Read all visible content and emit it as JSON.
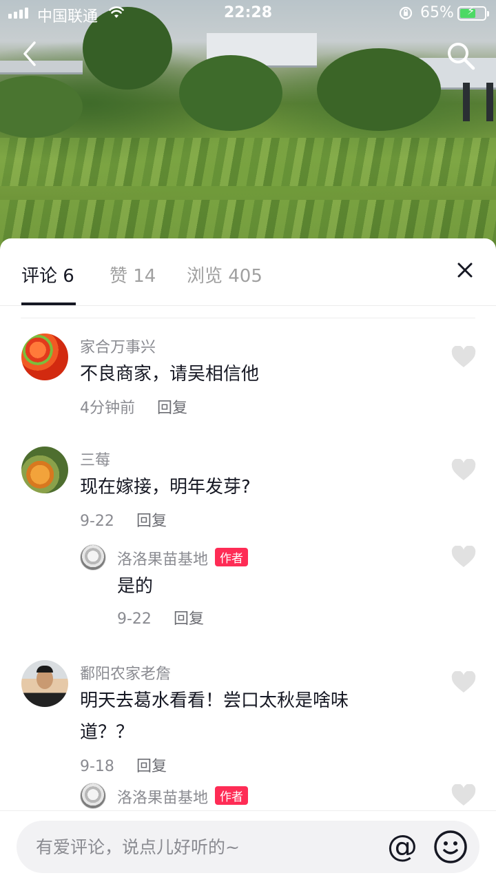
{
  "status_bar": {
    "carrier": "中国联通",
    "time": "22:28",
    "battery_percent": "65%",
    "battery_level": 0.65,
    "icons": [
      "signal-icon",
      "wifi-icon",
      "rotation-lock-icon",
      "battery-charging-icon"
    ]
  },
  "video": {
    "icons": [
      "back-arrow-icon",
      "search-icon"
    ]
  },
  "tabs": [
    {
      "label": "评论 6",
      "active": true
    },
    {
      "label": "赞 14",
      "active": false
    },
    {
      "label": "浏览 405",
      "active": false
    }
  ],
  "comments": [
    {
      "user": "家合万事兴",
      "text": "不良商家，请吴相信他",
      "time": "4分钟前",
      "reply": "回复"
    },
    {
      "user": "三莓",
      "text": "现在嫁接，明年发芽?",
      "time": "9-22",
      "reply": "回复"
    },
    {
      "user": "洛洛果苗基地",
      "tag": "作者",
      "text": "是的",
      "time": "9-22",
      "reply": "回复"
    },
    {
      "user": "鄱阳农家老詹",
      "text": "明天去葛水看看！尝口太秋是啥味道？？",
      "time": "9-18",
      "reply": "回复"
    },
    {
      "user": "洛洛果苗基地",
      "tag": "作者"
    }
  ],
  "input": {
    "placeholder": "有爱评论，说点儿好听的~",
    "value": "",
    "at_symbol": "@"
  },
  "colors": {
    "author_tag": "#fe2c55",
    "text_primary": "#161823",
    "text_secondary": "#8a8b91",
    "like_icon": "#e1e1e1",
    "battery_fill": "#4cd964"
  }
}
